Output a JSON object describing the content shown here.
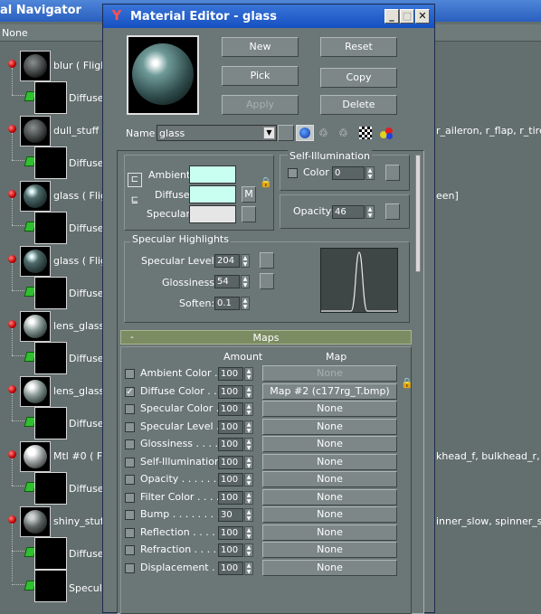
{
  "navigator": {
    "title": "al Navigator",
    "toolbar_text": "None",
    "rows": [
      {
        "name": "blur",
        "suffix": "( Flight",
        "child": "Diffuse (",
        "sphere": "dark"
      },
      {
        "name": "dull_stuff",
        "suffix": "(",
        "child": "Diffuse (",
        "sphere": "dark",
        "right": "r_aileron, r_flap, r_tire, r_"
      },
      {
        "name": "glass",
        "suffix": "( Flight",
        "child": "Diffuse (",
        "sphere": "glass",
        "right": "een]"
      },
      {
        "name": "glass",
        "suffix": "( Fligh",
        "child": "Diffuse (",
        "sphere": "glass"
      },
      {
        "name": "lens_glass",
        "suffix": "",
        "child": "Diffuse (",
        "sphere": "lens"
      },
      {
        "name": "lens_glass",
        "suffix": "",
        "child": "Diffuse (",
        "sphere": "lens"
      },
      {
        "name": "Mtl #0",
        "suffix": "( Flig",
        "child": "Diffuse (",
        "sphere": "bright",
        "right": "khead_f, bulkhead_r, co"
      },
      {
        "name": "shiny_stuff",
        "suffix": "",
        "child": "Diffuse (",
        "sphere": "shiny",
        "right": "inner_slow, spinner_still]",
        "child2": "Specula"
      }
    ]
  },
  "editor": {
    "title": "Material Editor - glass",
    "logo": "Y",
    "buttons": {
      "new": "New",
      "reset": "Reset",
      "pick": "Pick",
      "copy": "Copy",
      "apply": "Apply",
      "delete": "Delete"
    },
    "name_label": "Name",
    "name_value": "glass",
    "basic": {
      "ambient_label": "Ambient:",
      "diffuse_label": "Diffuse:",
      "specular_label": "Specular:",
      "m_button": "M",
      "self_illum_title": "Self-Illumination",
      "color_label": "Color",
      "color_value": "0",
      "opacity_label": "Opacity:",
      "opacity_value": "46",
      "ambient_color": "#c8fff0",
      "diffuse_color": "#c8fff0",
      "specular_color": "#e6e6e6"
    },
    "specular": {
      "title": "Specular Highlights",
      "level_label": "Specular Level:",
      "level_value": "204",
      "gloss_label": "Glossiness:",
      "gloss_value": "54",
      "soften_label": "Soften:",
      "soften_value": "0.1"
    },
    "maps": {
      "rollout_title": "Maps",
      "rollout_sign": "-",
      "col_amount": "Amount",
      "col_map": "Map",
      "rows": [
        {
          "label": "Ambient Color . . .",
          "amount": "100",
          "map": "None",
          "checked": false,
          "disabled": true
        },
        {
          "label": "Diffuse Color . . . .",
          "amount": "100",
          "map": "Map #2 (c177rg_T.bmp)",
          "checked": true,
          "disabled": false
        },
        {
          "label": "Specular Color . .",
          "amount": "100",
          "map": "None",
          "checked": false,
          "disabled": false
        },
        {
          "label": "Specular Level .",
          "amount": "100",
          "map": "None",
          "checked": false,
          "disabled": false
        },
        {
          "label": "Glossiness . . . . . .",
          "amount": "100",
          "map": "None",
          "checked": false,
          "disabled": false
        },
        {
          "label": "Self-Illumination .",
          "amount": "100",
          "map": "None",
          "checked": false,
          "disabled": false
        },
        {
          "label": "Opacity . . . . . . .",
          "amount": "100",
          "map": "None",
          "checked": false,
          "disabled": false
        },
        {
          "label": "Filter Color . . . . .",
          "amount": "100",
          "map": "None",
          "checked": false,
          "disabled": false
        },
        {
          "label": "Bump . . . . . . . .",
          "amount": "30",
          "map": "None",
          "checked": false,
          "disabled": false
        },
        {
          "label": "Reflection . . . . .",
          "amount": "100",
          "map": "None",
          "checked": false,
          "disabled": false
        },
        {
          "label": "Refraction . . . . .",
          "amount": "100",
          "map": "None",
          "checked": false,
          "disabled": false
        },
        {
          "label": "Displacement . .",
          "amount": "100",
          "map": "None",
          "checked": false,
          "disabled": false
        }
      ]
    }
  },
  "colors": {
    "titlebar": "#1550c0",
    "panel": "#6b7676",
    "rollout_bar": "#7c8c62"
  }
}
